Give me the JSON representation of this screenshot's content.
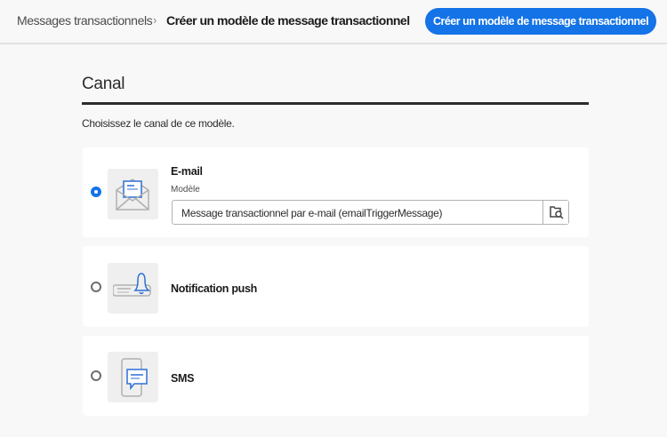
{
  "header": {
    "breadcrumb_parent": "Messages transactionnels",
    "breadcrumb_separator": "›",
    "breadcrumb_current": "Créer un modèle de message transactionnel",
    "create_button": "Créer un modèle de message transactionnel"
  },
  "section": {
    "title": "Canal",
    "subtitle": "Choisissez le canal de ce modèle."
  },
  "channels": [
    {
      "label": "E-mail",
      "selected": true,
      "model_label": "Modèle",
      "model_value": "Message transactionnel par e-mail (emailTriggerMessage)"
    },
    {
      "label": "Notification push",
      "selected": false
    },
    {
      "label": "SMS",
      "selected": false
    }
  ],
  "colors": {
    "accent": "#1473e6"
  }
}
